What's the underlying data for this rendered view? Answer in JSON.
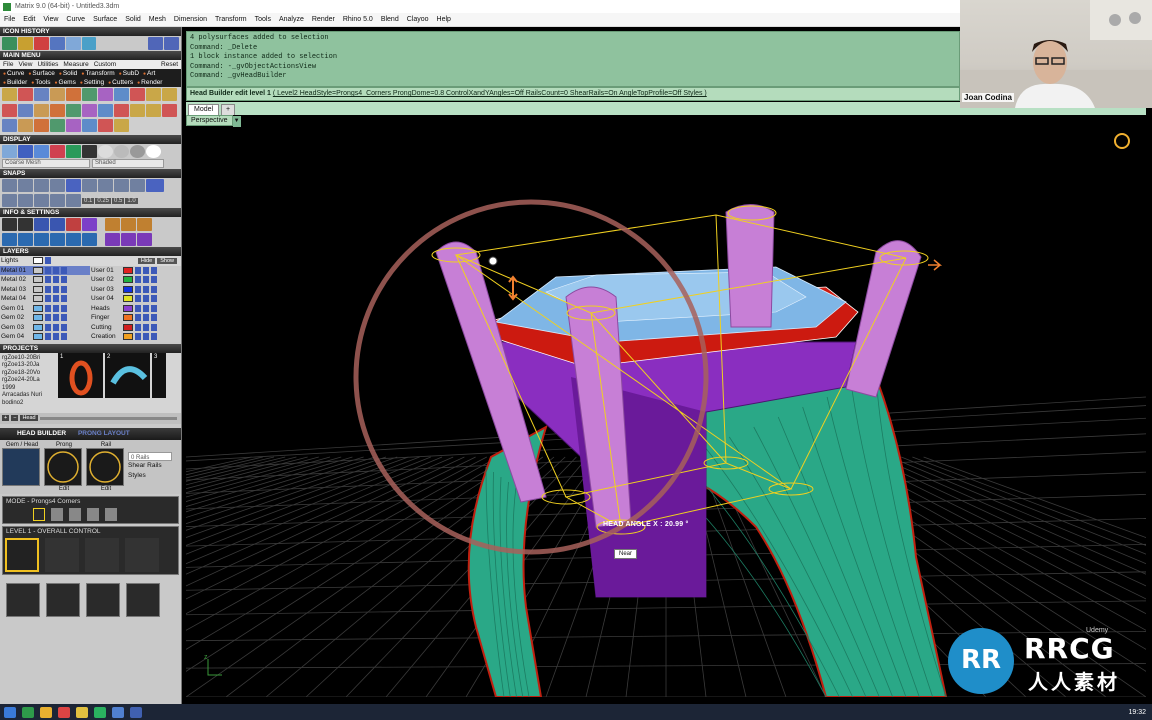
{
  "window": {
    "title": "Matrix 9.0 (64-bit) - Untitled3.3dm"
  },
  "menubar": [
    "File",
    "Edit",
    "View",
    "Curve",
    "Surface",
    "Solid",
    "Mesh",
    "Dimension",
    "Transform",
    "Tools",
    "Analyze",
    "Render",
    "Rhino 5.0",
    "Blend",
    "Clayoo",
    "Help"
  ],
  "left_panel": {
    "icon_history_title": "ICON HISTORY",
    "main_menu_title": "MAIN MENU",
    "main_menu_bar": [
      "File",
      "View",
      "Utilities",
      "Measure",
      "Custom",
      "Reset"
    ],
    "main_menu_items": [
      "Curve",
      "Surface",
      "Solid",
      "Transform",
      "SubD",
      "Art",
      "Builder",
      "Tools",
      "Gems",
      "Setting",
      "Cutters",
      "Render"
    ],
    "display_title": "DISPLAY",
    "display_dropdowns": [
      "Coarse Mesh",
      "Shaded"
    ],
    "snaps_title": "SNAPS",
    "snap_values": [
      "0.1",
      "0.25",
      "0.5",
      "1.0"
    ],
    "info_title": "INFO & SETTINGS",
    "layers_title": "LAYERS",
    "layers_top": {
      "lights": "Lights",
      "hide": "Hide",
      "show": "Show"
    },
    "layers_left": [
      "Metal 01",
      "Metal 02",
      "Metal 03",
      "Metal 04",
      "Gem 01",
      "Gem 02",
      "Gem 03",
      "Gem 04"
    ],
    "layers_right": [
      "User 01",
      "User 02",
      "User 03",
      "User 04",
      "Heads",
      "Finger",
      "Cutting",
      "Creation"
    ],
    "layers_right_colors": [
      "#e02020",
      "#20b040",
      "#1030e0",
      "#e0e020",
      "#8a3fd0",
      "#f07020",
      "#d02020",
      "#f0a020"
    ],
    "layers_left_colors": [
      "#c8c8c8",
      "#c8c8c8",
      "#c8c8c8",
      "#c8c8c8",
      "#6fb6e8",
      "#6fb6e8",
      "#6fb6e8",
      "#6fb6e8"
    ],
    "projects_title": "PROJECTS",
    "projects_list": [
      "rgZoe10-20Bri",
      "rgZoe13-20Ja",
      "rgZoe18-20Vo",
      "rgZoe24-20La",
      "1999",
      "Arracadas Nuri",
      "bodino2"
    ],
    "project_thumbs": [
      "1",
      "2",
      "3"
    ],
    "project_footer": "Head",
    "head_builder_title": "HEAD BUILDER",
    "prong_layout_label": "PRONG LAYOUT",
    "head_cols": [
      "Gem / Head",
      "Prong",
      "Rail"
    ],
    "edit_labels": [
      "Edit",
      "Edit"
    ],
    "rails_value": "0 Rails",
    "shear_rails_label": "Shear Rails",
    "styles_label": "Styles",
    "mode_label": "MODE - Prongs4 Corners",
    "level_label": "LEVEL 1 - OVERALL CONTROL"
  },
  "command_history": [
    "4 polysurfaces added to selection",
    "Command: _Delete",
    "1 block instance added to selection",
    "Command: -_gvObjectActionsView",
    "Command: _gvHeadBuilder"
  ],
  "command_prompt": {
    "lead": "Head Builder edit level 1",
    "options": "( Level2  HeadStyle=Prongs4_Corners  ProngDome=0.8  ControlXandYAngles=Off  RailsCount=0  ShearRails=On  AngleTopProfile=Off  Styles )"
  },
  "viewport": {
    "tabs": [
      "Model"
    ],
    "add_tab": "+",
    "title": "Perspective",
    "hud_angle": "HEAD ANGLE X : 20.99 °",
    "snap_tooltip": "Near",
    "axis_x": "x",
    "axis_z": "z",
    "udemy": "Udemy"
  },
  "watermark": {
    "logo": "RR",
    "text": "RRCG",
    "sub": "人人素材"
  },
  "webcam": {
    "name": "Joan Codina"
  },
  "taskbar": {
    "clock": "19:32"
  },
  "colors": {
    "command_bg": "#8fc29e",
    "prong": "#c77fd6",
    "gem_table": "#7fb6e6",
    "gem_girdle": "#cc1a10",
    "shank": "#2aa887",
    "head_purple": "#7f2fb0",
    "guide": "#f0d020"
  }
}
